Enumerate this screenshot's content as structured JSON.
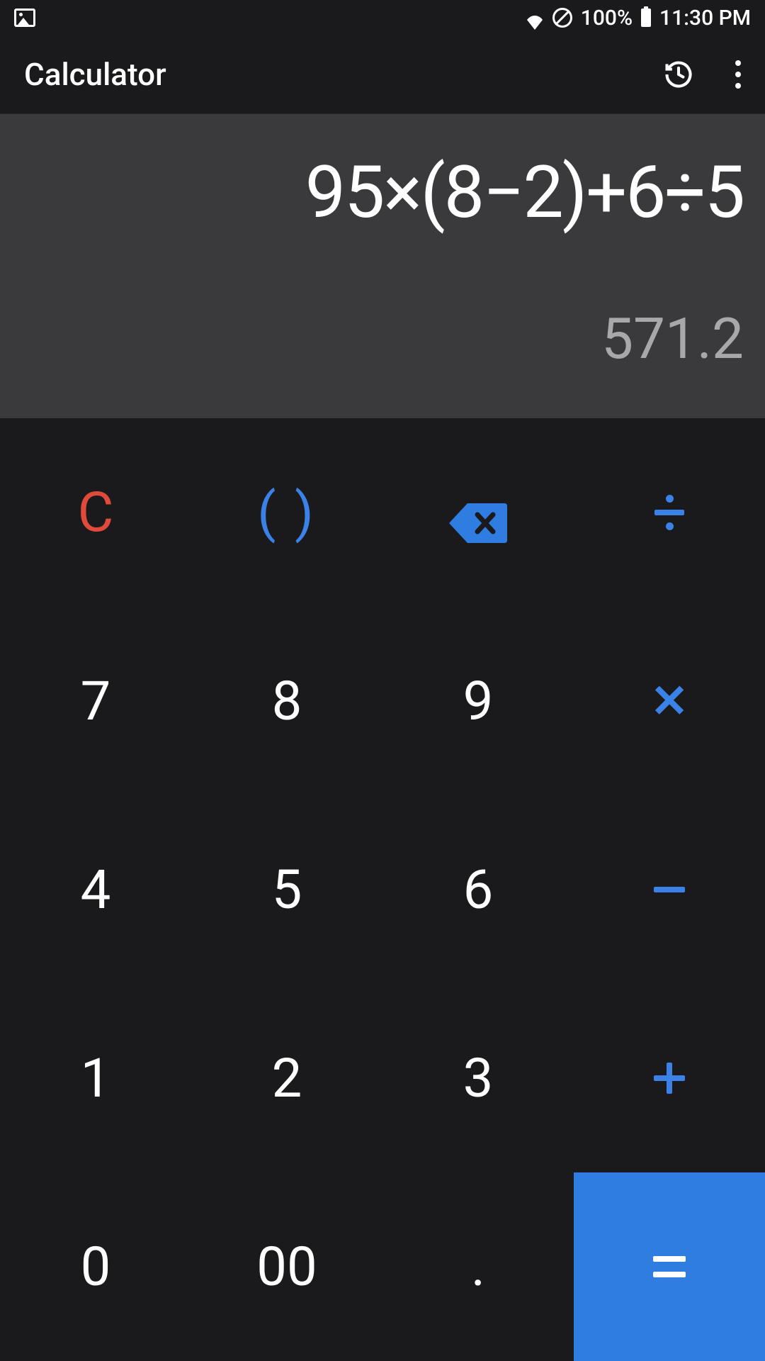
{
  "status_bar": {
    "battery_pct": "100%",
    "time": "11:30 PM"
  },
  "app_bar": {
    "title": "Calculator"
  },
  "display": {
    "expression": "95×(8−2)+6÷5",
    "result": "571.2"
  },
  "keys": {
    "clear": "C",
    "parens": "( )",
    "k7": "7",
    "k8": "8",
    "k9": "9",
    "k4": "4",
    "k5": "5",
    "k6": "6",
    "k1": "1",
    "k2": "2",
    "k3": "3",
    "k0": "0",
    "k00": "00",
    "dot": "."
  }
}
